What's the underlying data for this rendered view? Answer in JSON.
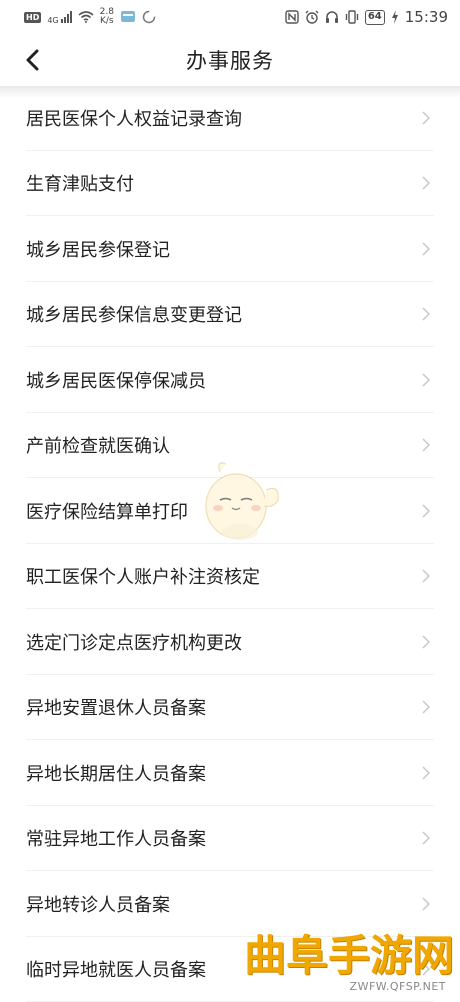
{
  "status_bar": {
    "hd": "HD",
    "net_type": "4G",
    "speed_value": "2.8",
    "speed_unit": "K/s",
    "battery": "64",
    "time": "15:39"
  },
  "header": {
    "title": "办事服务"
  },
  "list": {
    "items": [
      {
        "label": "居民医保个人权益记录查询"
      },
      {
        "label": "生育津贴支付"
      },
      {
        "label": "城乡居民参保登记"
      },
      {
        "label": "城乡居民参保信息变更登记"
      },
      {
        "label": "城乡居民医保停保减员"
      },
      {
        "label": "产前检查就医确认"
      },
      {
        "label": "医疗保险结算单打印"
      },
      {
        "label": "职工医保个人账户补注资核定"
      },
      {
        "label": "选定门诊定点医疗机构更改"
      },
      {
        "label": "异地安置退休人员备案"
      },
      {
        "label": "异地长期居住人员备案"
      },
      {
        "label": "常驻异地工作人员备案"
      },
      {
        "label": "异地转诊人员备案"
      },
      {
        "label": "临时异地就医人员备案"
      }
    ]
  },
  "watermark": {
    "text": "曲阜手游网",
    "url": "ZWFW.QFSP.NET"
  },
  "colors": {
    "watermark": "#f0a800",
    "chevron": "#c8c8c8",
    "divider": "#f0f0f0"
  }
}
